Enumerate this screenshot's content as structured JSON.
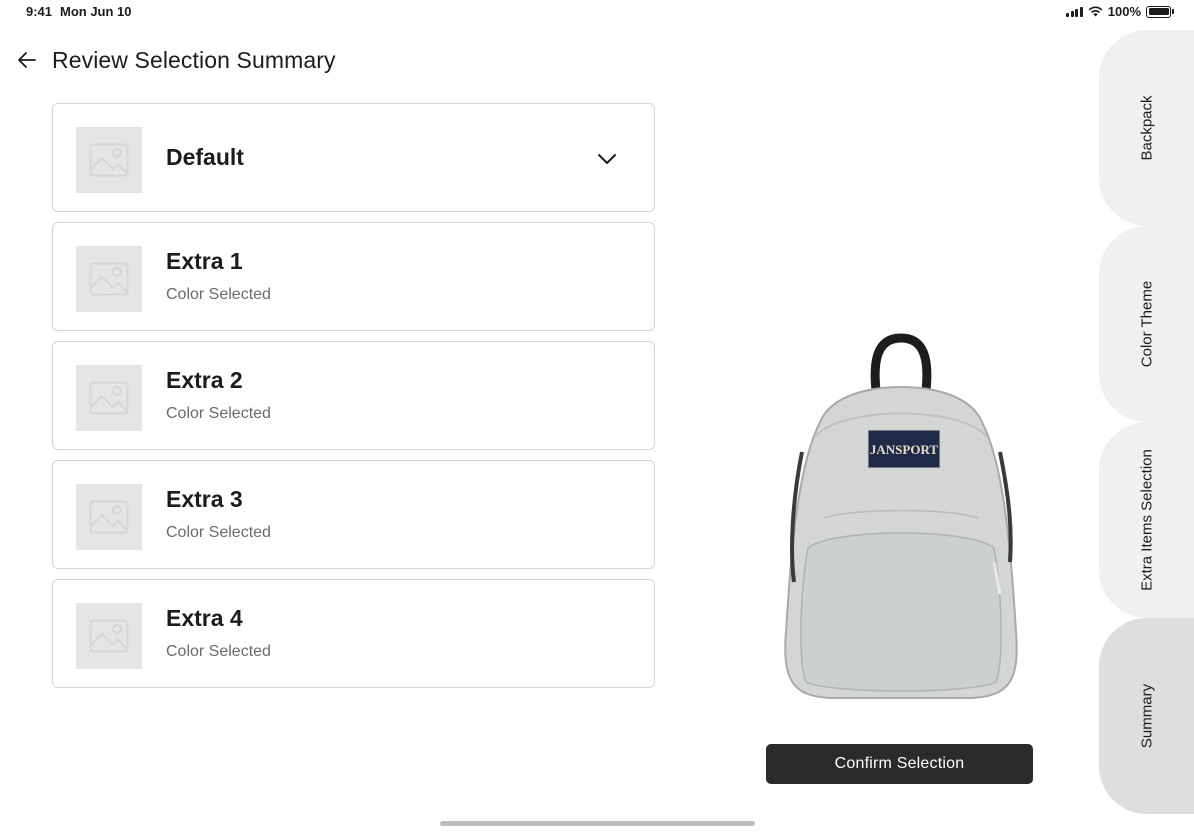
{
  "status_bar": {
    "time": "9:41",
    "date": "Mon Jun 10",
    "battery": "100%"
  },
  "header": {
    "title": "Review Selection Summary"
  },
  "items": [
    {
      "title": "Default",
      "subtitle": ""
    },
    {
      "title": "Extra 1",
      "subtitle": "Color Selected"
    },
    {
      "title": "Extra 2",
      "subtitle": "Color Selected"
    },
    {
      "title": "Extra 3",
      "subtitle": "Color Selected"
    },
    {
      "title": "Extra 4",
      "subtitle": "Color Selected"
    }
  ],
  "preview": {
    "brand_label": "JANSPORT",
    "confirm_label": "Confirm Selection"
  },
  "side_tabs": [
    {
      "label": "Backpack",
      "active": false
    },
    {
      "label": "Color Theme",
      "active": false
    },
    {
      "label": "Extra Items Selection",
      "active": false
    },
    {
      "label": "Summary",
      "active": true
    }
  ],
  "colors": {
    "accent": "#2b2b2b",
    "tab_bg": "#f0f0f0",
    "tab_active_bg": "#dedede",
    "placeholder": "#e5e5e5"
  }
}
